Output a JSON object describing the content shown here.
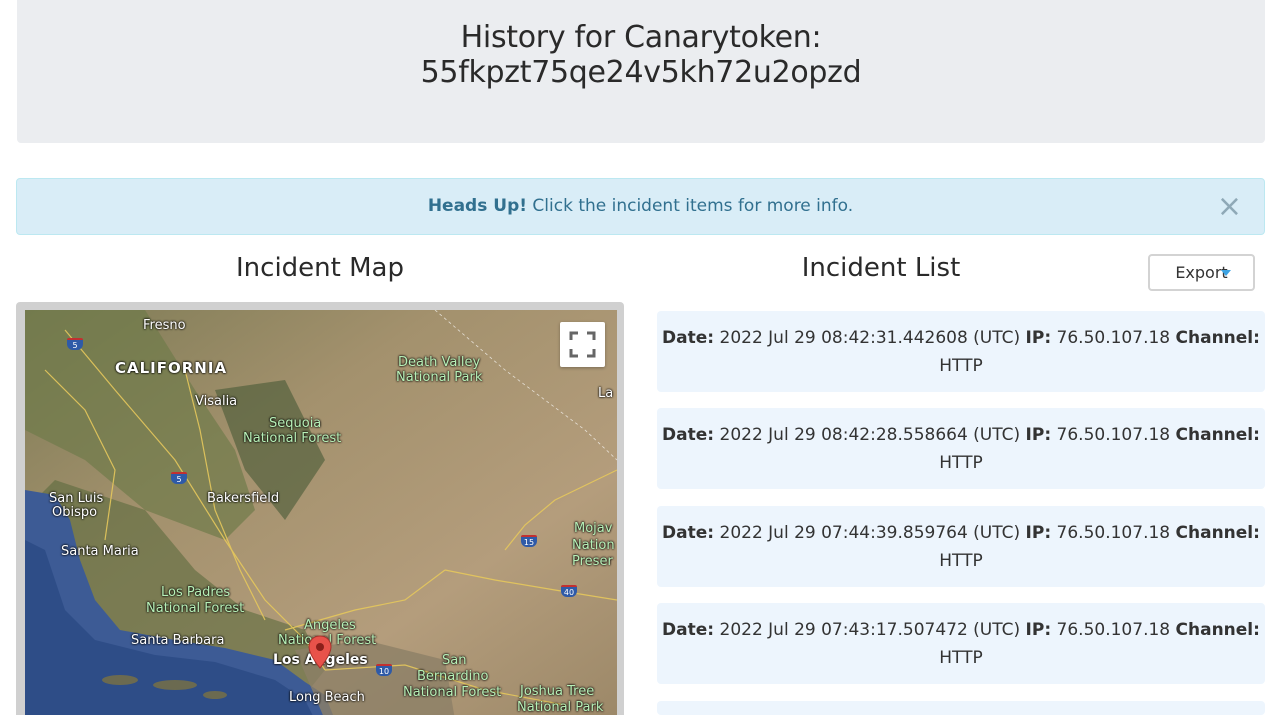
{
  "header": {
    "title_line1": "History for Canarytoken:",
    "title_line2": "55fkpzt75qe24v5kh72u2opzd"
  },
  "alert": {
    "strong": "Heads Up!",
    "text": " Click the incident items for more info.",
    "close": "×"
  },
  "map_section": {
    "title": "Incident Map",
    "labels": {
      "fresno": "Fresno",
      "california": "CALIFORNIA",
      "visalia": "Visalia",
      "sequoia1": "Sequoia",
      "sequoia2": "National Forest",
      "deathvalley1": "Death Valley",
      "deathvalley2": "National Park",
      "la_edge": "La",
      "sanluis1": "San Luis",
      "sanluis2": "Obispo",
      "bakersfield": "Bakersfield",
      "santamaria": "Santa Maria",
      "mojave1": "Mojav",
      "mojave2": "Nation",
      "mojave3": "Preser",
      "lospadres1": "Los Padres",
      "lospadres2": "National Forest",
      "angeles1": "Angeles",
      "angeles2": "National Forest",
      "santabarbara": "Santa Barbara",
      "losangeles": "Los Angeles",
      "sanbern1": "San",
      "sanbern2": "Bernardino",
      "sanbern3": "National Forest",
      "longbeach": "Long Beach",
      "joshua1": "Joshua Tree",
      "joshua2": "National Park"
    },
    "highways": {
      "h5a": "5",
      "h5b": "5",
      "h15": "15",
      "h40": "40",
      "h10": "10"
    }
  },
  "list_section": {
    "title": "Incident List",
    "export_label": "Export",
    "date_label": "Date:",
    "ip_label": "IP:",
    "channel_label": "Channel:",
    "incidents": [
      {
        "date": "2022 Jul 29 08:42:31.442608 (UTC)",
        "ip": "76.50.107.18",
        "channel": "HTTP"
      },
      {
        "date": "2022 Jul 29 08:42:28.558664 (UTC)",
        "ip": "76.50.107.18",
        "channel": "HTTP"
      },
      {
        "date": "2022 Jul 29 07:44:39.859764 (UTC)",
        "ip": "76.50.107.18",
        "channel": "HTTP"
      },
      {
        "date": "2022 Jul 29 07:43:17.507472 (UTC)",
        "ip": "76.50.107.18",
        "channel": "HTTP"
      }
    ]
  },
  "colors": {
    "header_bg": "#ebedf0",
    "alert_bg": "#d9edf7",
    "alert_text": "#31708f",
    "incident_bg": "#edf5fd",
    "marker": "#e8524a"
  }
}
